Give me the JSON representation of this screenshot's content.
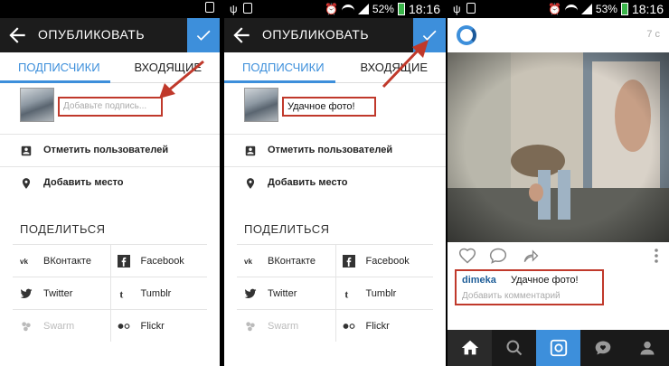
{
  "status": {
    "p1_time": "",
    "p2_time": "18:16",
    "p2_battery": "52%",
    "p3_time": "18:16",
    "p3_battery": "53%"
  },
  "publish": {
    "title": "ОПУБЛИКОВАТЬ",
    "tab_followers": "ПОДПИСЧИКИ",
    "tab_direct": "ВХОДЯЩИЕ",
    "caption_placeholder": "Добавьте подпись...",
    "caption_filled": "Удачное фото!",
    "tag_people": "Отметить пользователей",
    "add_location": "Добавить место",
    "share_heading": "ПОДЕЛИТЬСЯ",
    "share": {
      "vk": "ВКонтакте",
      "facebook": "Facebook",
      "twitter": "Twitter",
      "tumblr": "Tumblr",
      "swarm": "Swarm",
      "flickr": "Flickr"
    }
  },
  "feed": {
    "time_ago": "7 c",
    "username": "dimeka",
    "caption": "Удачное фото!",
    "add_comment": "Добавить комментарий"
  },
  "colors": {
    "accent": "#3d8fdb",
    "highlight": "#c0392b",
    "appbar": "#1c1c1c"
  }
}
